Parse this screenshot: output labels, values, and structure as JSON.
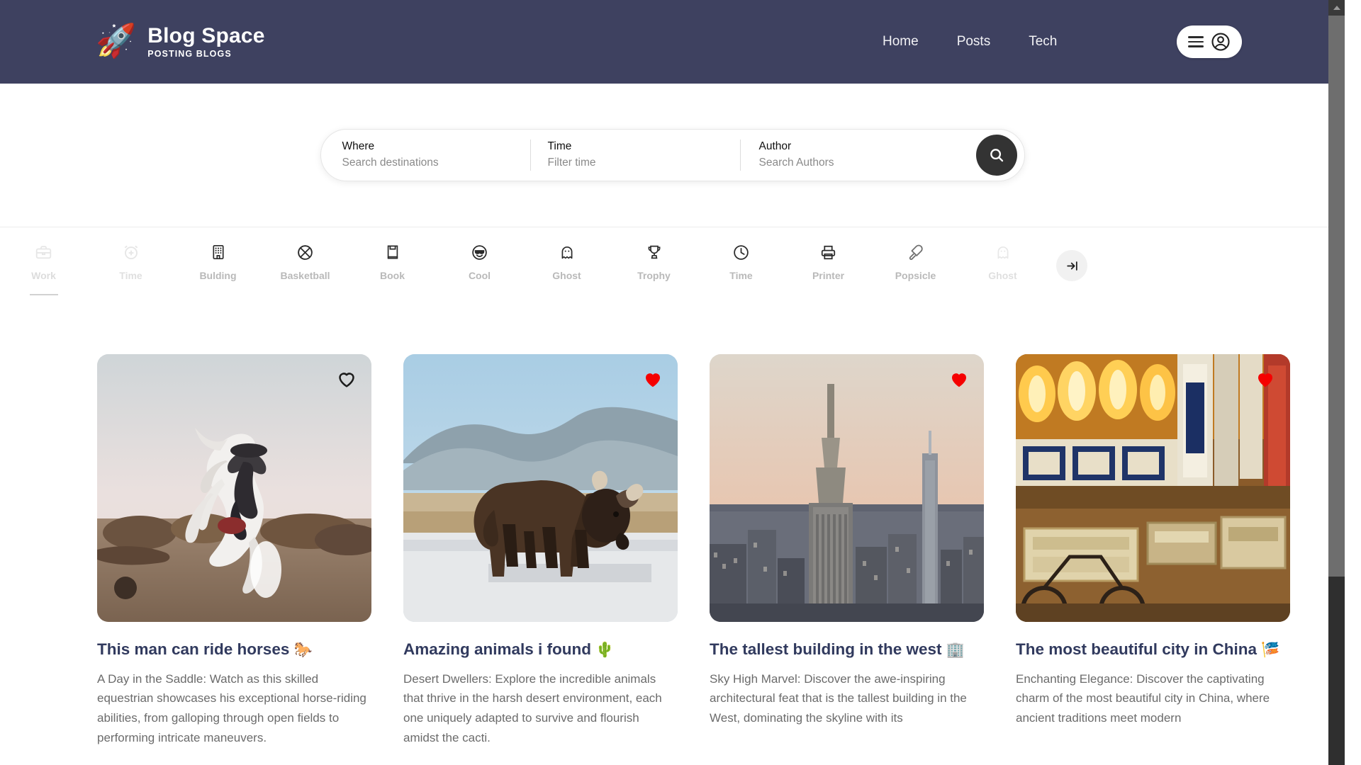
{
  "header": {
    "logo_icon": "rocket-icon",
    "brand_title": "Blog Space",
    "brand_subtitle": "POSTING BLOGS",
    "background_color": "#3e4160",
    "nav": [
      {
        "label": "Home"
      },
      {
        "label": "Posts"
      },
      {
        "label": "Tech"
      }
    ],
    "user_menu": {
      "menu_icon": "hamburger-icon",
      "account_icon": "user-circle-icon"
    }
  },
  "search": {
    "where": {
      "label": "Where",
      "placeholder": "Search destinations",
      "value": ""
    },
    "time": {
      "label": "Time",
      "placeholder": "Filter time",
      "value": ""
    },
    "author": {
      "label": "Author",
      "placeholder": "Search Authors",
      "value": ""
    },
    "search_button_icon": "search-icon"
  },
  "categories": {
    "active_index": 0,
    "next_button_icon": "arrow-to-right-icon",
    "items": [
      {
        "label": "Work",
        "icon": "briefcase-icon",
        "muted": true
      },
      {
        "label": "Time",
        "icon": "alarm-plus-icon",
        "muted": true
      },
      {
        "label": "Bulding",
        "icon": "building-icon",
        "muted": false
      },
      {
        "label": "Basketball",
        "icon": "basketball-icon",
        "muted": false
      },
      {
        "label": "Book",
        "icon": "book-icon",
        "muted": false
      },
      {
        "label": "Cool",
        "icon": "cool-face-icon",
        "muted": false
      },
      {
        "label": "Ghost",
        "icon": "ghost-icon",
        "muted": false
      },
      {
        "label": "Trophy",
        "icon": "trophy-icon",
        "muted": false
      },
      {
        "label": "Time",
        "icon": "clock-icon",
        "muted": false
      },
      {
        "label": "Printer",
        "icon": "printer-icon",
        "muted": false
      },
      {
        "label": "Popsicle",
        "icon": "popsicle-icon",
        "muted": false
      },
      {
        "label": "Ghost",
        "icon": "ghost-icon",
        "muted": true
      }
    ]
  },
  "posts": [
    {
      "image_alt": "Man riding a rearing white horse among a herd",
      "favorite": false,
      "favorite_icon": "heart-outline-icon",
      "title": "This man can ride horses",
      "emoji": "🐎",
      "description": "A Day in the Saddle: Watch as this skilled equestrian showcases his exceptional horse-riding abilities, from galloping through open fields to performing intricate maneuvers."
    },
    {
      "image_alt": "Bison standing on snowy plain with mountains behind",
      "favorite": true,
      "favorite_icon": "heart-filled-icon",
      "title": "Amazing animals i found",
      "emoji": "🌵",
      "description": "Desert Dwellers: Explore the incredible animals that thrive in the harsh desert environment, each one uniquely adapted to survive and flourish amidst the cacti."
    },
    {
      "image_alt": "Empire State Building above the New York skyline at dusk",
      "favorite": true,
      "favorite_icon": "heart-filled-icon",
      "title": "The tallest building in the west",
      "emoji": "🏢",
      "description": "Sky High Marvel: Discover the awe-inspiring architectural feat that is the tallest building in the West, dominating the skyline with its"
    },
    {
      "image_alt": "Japanese street market with red lanterns and signage",
      "favorite": true,
      "favorite_icon": "heart-filled-icon",
      "title": "The most beautiful city in China",
      "emoji": "🎏",
      "description": "Enchanting Elegance: Discover the captivating charm of the most beautiful city in China, where ancient traditions meet modern"
    }
  ],
  "scrollbar": {
    "position": "right",
    "thumb_color": "#6e6e6e"
  }
}
